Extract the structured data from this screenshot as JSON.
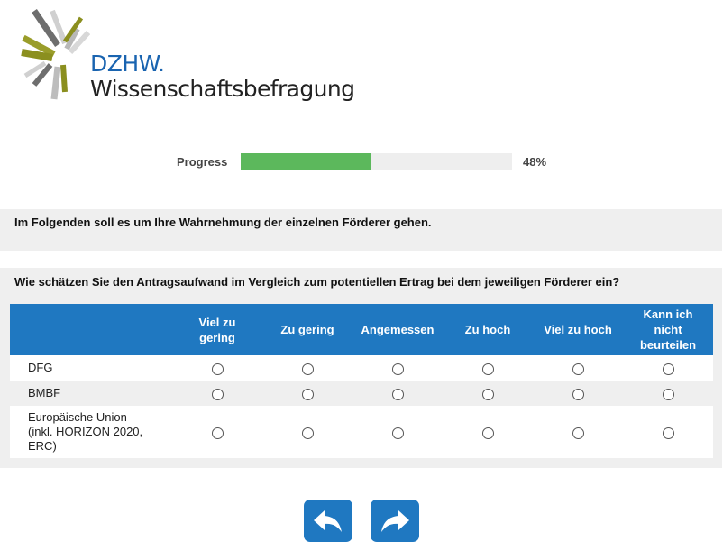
{
  "logo": {
    "brand": "DZHW.",
    "subtitle": "Wissenschaftsbefragung",
    "colors": {
      "blue": "#1a64b0",
      "olive": "#8b8f1f",
      "grey": "#707070"
    }
  },
  "progress": {
    "label": "Progress",
    "value_text": "48%",
    "fraction": 0.48,
    "color": "#5cb85c"
  },
  "intro": {
    "text": "Im Folgenden soll es um Ihre Wahrnehmung der einzelnen Förderer gehen."
  },
  "question": {
    "text": "Wie schätzen Sie den Antragsaufwand im Vergleich zum potentiellen Ertrag bei dem jeweiligen Förderer ein?",
    "header_color": "#1f78c1",
    "columns": [
      "Viel zu\ngering",
      "Zu gering",
      "Angemessen",
      "Zu hoch",
      "Viel zu hoch",
      "Kann ich\nnicht\nbeurteilen"
    ],
    "rows": [
      "DFG",
      "BMBF",
      "Europäische Union\n(inkl. HORIZON 2020,\nERC)"
    ]
  },
  "navigation": {
    "back_icon": "arrow-back-icon",
    "next_icon": "arrow-forward-icon"
  }
}
